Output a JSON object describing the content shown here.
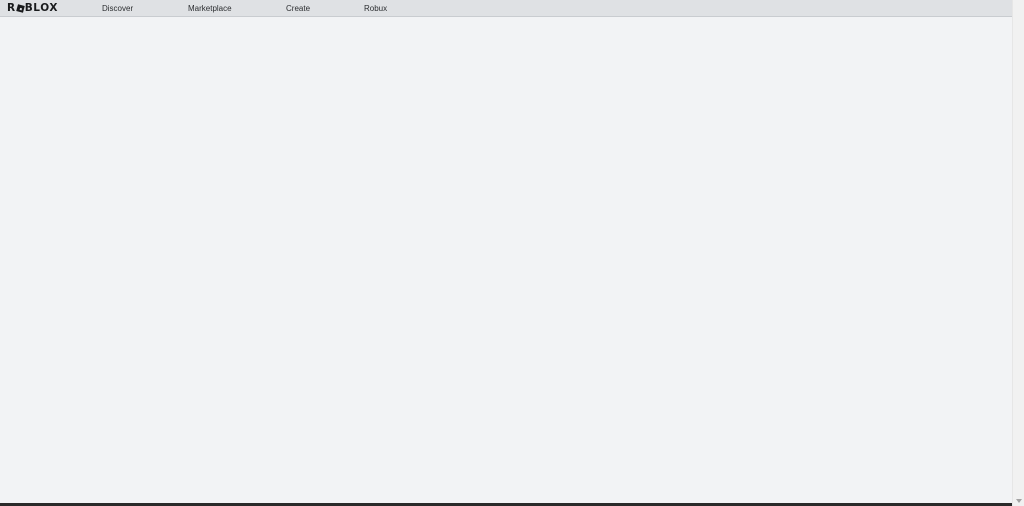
{
  "header": {
    "logo_text_left": "R",
    "logo_text_right": "BLOX",
    "nav": [
      {
        "label": "Discover"
      },
      {
        "label": "Marketplace"
      },
      {
        "label": "Create"
      },
      {
        "label": "Robux"
      }
    ]
  },
  "colors": {
    "header_bg": "#dfe1e4",
    "page_bg": "#f2f3f5",
    "text": "#1a1b1d"
  }
}
